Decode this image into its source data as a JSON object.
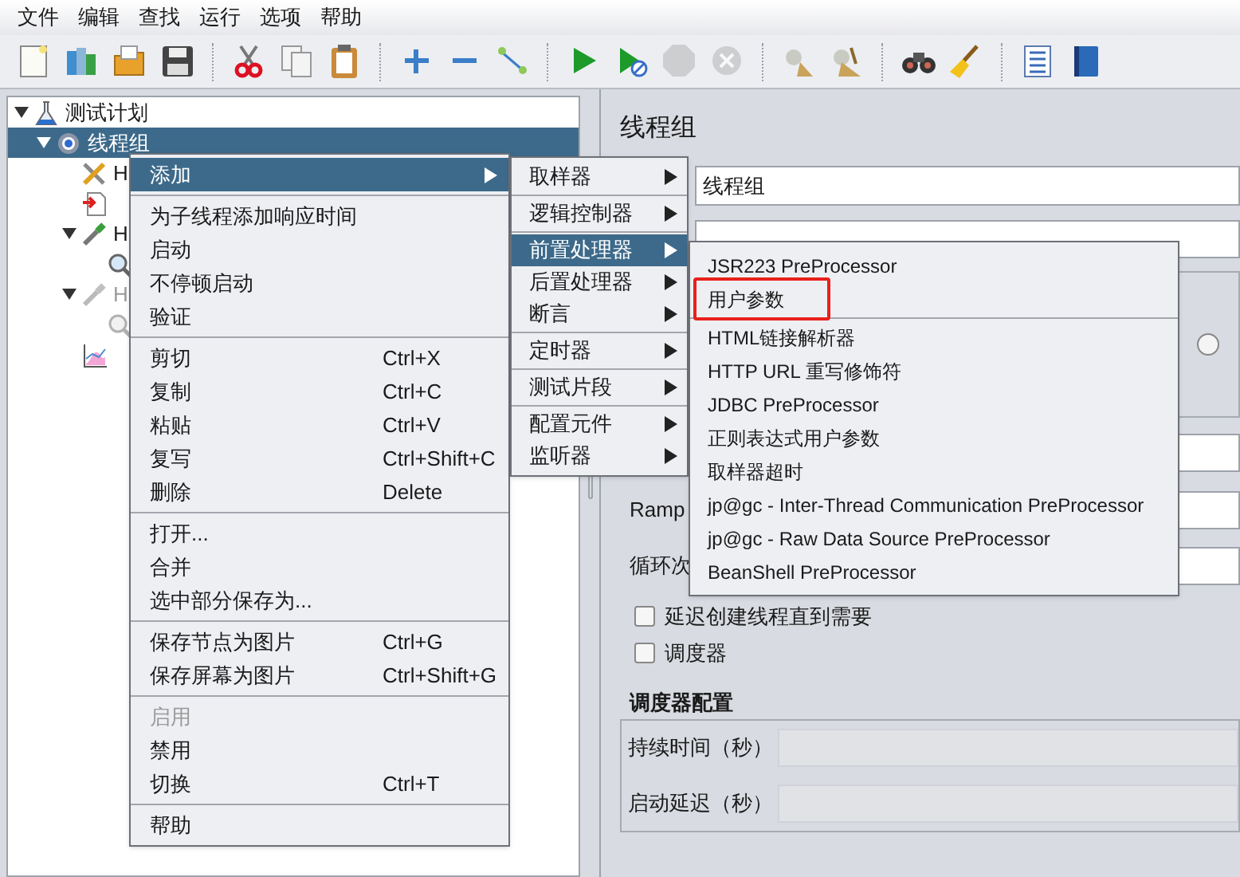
{
  "menu_bar": [
    {
      "label": "文件"
    },
    {
      "label": "编辑"
    },
    {
      "label": "查找"
    },
    {
      "label": "运行"
    },
    {
      "label": "选项"
    },
    {
      "label": "帮助"
    }
  ],
  "toolbar": [
    {
      "kind": "new",
      "disabled": false
    },
    {
      "kind": "templates",
      "disabled": false
    },
    {
      "kind": "open",
      "disabled": false
    },
    {
      "kind": "save",
      "disabled": false
    },
    {
      "kind": "separator"
    },
    {
      "kind": "cut",
      "disabled": false
    },
    {
      "kind": "copy",
      "disabled": false
    },
    {
      "kind": "paste",
      "disabled": false
    },
    {
      "kind": "separator"
    },
    {
      "kind": "expand",
      "disabled": false
    },
    {
      "kind": "collapse",
      "disabled": false
    },
    {
      "kind": "toggle",
      "disabled": false
    },
    {
      "kind": "separator"
    },
    {
      "kind": "start",
      "disabled": false
    },
    {
      "kind": "start_no_pause",
      "disabled": false
    },
    {
      "kind": "stop",
      "disabled": true
    },
    {
      "kind": "shutdown",
      "disabled": true
    },
    {
      "kind": "separator"
    },
    {
      "kind": "clear",
      "disabled": false
    },
    {
      "kind": "clear_all",
      "disabled": false
    },
    {
      "kind": "separator"
    },
    {
      "kind": "search",
      "disabled": false
    },
    {
      "kind": "reset_search",
      "disabled": false
    },
    {
      "kind": "separator"
    },
    {
      "kind": "function_helper",
      "disabled": false
    },
    {
      "kind": "help",
      "disabled": false
    }
  ],
  "tree": [
    {
      "label": "测试计划",
      "kind": "plan",
      "expanded": true,
      "selected": false,
      "disabled": false,
      "children": [
        {
          "label": "线程组",
          "kind": "thread_group",
          "expanded": true,
          "selected": true,
          "disabled": false,
          "children": [
            {
              "label": "H",
              "kind": "tools",
              "selected": false,
              "disabled": false
            },
            {
              "kind": "document",
              "selected": false,
              "disabled": false
            },
            {
              "label": "H",
              "kind": "dropper",
              "expanded": true,
              "selected": false,
              "disabled": false,
              "children": [
                {
                  "kind": "magnifier",
                  "selected": false,
                  "disabled": false
                }
              ]
            },
            {
              "label": "H",
              "kind": "dropper",
              "expanded": true,
              "selected": false,
              "disabled": true,
              "children": [
                {
                  "kind": "magnifier",
                  "selected": false,
                  "disabled": true
                }
              ]
            },
            {
              "kind": "graph",
              "selected": false,
              "disabled": false
            }
          ]
        }
      ]
    }
  ],
  "panel": {
    "title": "线程组",
    "name_value": "线程组",
    "option": {
      "selected": false
    },
    "ramp_label": "Ramp",
    "loop_label": "循环次",
    "checkboxes": [
      {
        "label": "延迟创建线程直到需要",
        "checked": false
      },
      {
        "label": "调度器",
        "checked": false
      }
    ],
    "scheduler": {
      "title": "调度器配置",
      "fields": [
        {
          "label": "持续时间（秒）",
          "disabled": true
        },
        {
          "label": "启动延迟（秒）",
          "disabled": true
        }
      ]
    }
  },
  "context_menu": [
    {
      "kind": "item",
      "label": "添加",
      "selected": true,
      "submenu": true,
      "disabled": false
    },
    {
      "kind": "separator"
    },
    {
      "kind": "item",
      "label": "为子线程添加响应时间",
      "selected": false,
      "submenu": false,
      "disabled": false
    },
    {
      "kind": "item",
      "label": "启动",
      "selected": false,
      "submenu": false,
      "disabled": false
    },
    {
      "kind": "item",
      "label": "不停顿启动",
      "selected": false,
      "submenu": false,
      "disabled": false
    },
    {
      "kind": "item",
      "label": "验证",
      "selected": false,
      "submenu": false,
      "disabled": false
    },
    {
      "kind": "separator"
    },
    {
      "kind": "item",
      "label": "剪切",
      "shortcut": "Ctrl+X",
      "selected": false,
      "submenu": false,
      "disabled": false
    },
    {
      "kind": "item",
      "label": "复制",
      "shortcut": "Ctrl+C",
      "selected": false,
      "submenu": false,
      "disabled": false
    },
    {
      "kind": "item",
      "label": "粘贴",
      "shortcut": "Ctrl+V",
      "selected": false,
      "submenu": false,
      "disabled": false
    },
    {
      "kind": "item",
      "label": "复写",
      "shortcut": "Ctrl+Shift+C",
      "selected": false,
      "submenu": false,
      "disabled": false
    },
    {
      "kind": "item",
      "label": "删除",
      "shortcut": "Delete",
      "selected": false,
      "submenu": false,
      "disabled": false
    },
    {
      "kind": "separator"
    },
    {
      "kind": "item",
      "label": "打开...",
      "selected": false,
      "submenu": false,
      "disabled": false
    },
    {
      "kind": "item",
      "label": "合并",
      "selected": false,
      "submenu": false,
      "disabled": false
    },
    {
      "kind": "item",
      "label": "选中部分保存为...",
      "selected": false,
      "submenu": false,
      "disabled": false
    },
    {
      "kind": "separator"
    },
    {
      "kind": "item",
      "label": "保存节点为图片",
      "shortcut": "Ctrl+G",
      "selected": false,
      "submenu": false,
      "disabled": false
    },
    {
      "kind": "item",
      "label": "保存屏幕为图片",
      "shortcut": "Ctrl+Shift+G",
      "selected": false,
      "submenu": false,
      "disabled": false
    },
    {
      "kind": "separator"
    },
    {
      "kind": "item",
      "label": "启用",
      "selected": false,
      "submenu": false,
      "disabled": true
    },
    {
      "kind": "item",
      "label": "禁用",
      "selected": false,
      "submenu": false,
      "disabled": false
    },
    {
      "kind": "item",
      "label": "切换",
      "shortcut": "Ctrl+T",
      "selected": false,
      "submenu": false,
      "disabled": false
    },
    {
      "kind": "separator"
    },
    {
      "kind": "item",
      "label": "帮助",
      "selected": false,
      "submenu": false,
      "disabled": false
    }
  ],
  "add_submenu": [
    {
      "kind": "item",
      "label": "取样器",
      "selected": false,
      "submenu": true
    },
    {
      "kind": "separator"
    },
    {
      "kind": "item",
      "label": "逻辑控制器",
      "selected": false,
      "submenu": true
    },
    {
      "kind": "separator"
    },
    {
      "kind": "item",
      "label": "前置处理器",
      "selected": true,
      "submenu": true
    },
    {
      "kind": "item",
      "label": "后置处理器",
      "selected": false,
      "submenu": true
    },
    {
      "kind": "item",
      "label": "断言",
      "selected": false,
      "submenu": true
    },
    {
      "kind": "separator"
    },
    {
      "kind": "item",
      "label": "定时器",
      "selected": false,
      "submenu": true
    },
    {
      "kind": "separator"
    },
    {
      "kind": "item",
      "label": "测试片段",
      "selected": false,
      "submenu": true
    },
    {
      "kind": "separator"
    },
    {
      "kind": "item",
      "label": "配置元件",
      "selected": false,
      "submenu": true
    },
    {
      "kind": "item",
      "label": "监听器",
      "selected": false,
      "submenu": true
    }
  ],
  "preprocessor_submenu": [
    {
      "kind": "item",
      "label": "JSR223 PreProcessor",
      "selected": false,
      "annotated": false
    },
    {
      "kind": "item",
      "label": "用户参数",
      "selected": false,
      "annotated": true
    },
    {
      "kind": "separator"
    },
    {
      "kind": "item",
      "label": "HTML链接解析器",
      "selected": false,
      "annotated": false
    },
    {
      "kind": "item",
      "label": "HTTP URL 重写修饰符",
      "selected": false,
      "annotated": false
    },
    {
      "kind": "item",
      "label": "JDBC PreProcessor",
      "selected": false,
      "annotated": false
    },
    {
      "kind": "item",
      "label": "正则表达式用户参数",
      "selected": false,
      "annotated": false
    },
    {
      "kind": "item",
      "label": "取样器超时",
      "selected": false,
      "annotated": false
    },
    {
      "kind": "item",
      "label": "jp@gc - Inter-Thread Communication PreProcessor",
      "selected": false,
      "annotated": false
    },
    {
      "kind": "item",
      "label": "jp@gc - Raw Data Source PreProcessor",
      "selected": false,
      "annotated": false
    },
    {
      "kind": "item",
      "label": "BeanShell PreProcessor",
      "selected": false,
      "annotated": false
    }
  ]
}
